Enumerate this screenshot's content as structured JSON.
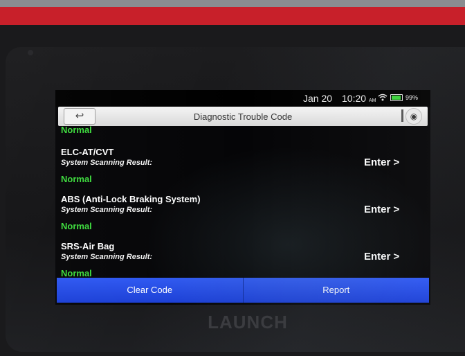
{
  "status_bar": {
    "date": "Jan 20",
    "time": "10:20",
    "ampm": "AM",
    "battery_percent": "99%",
    "wifi_icon": "wifi-icon",
    "battery_icon": "battery-icon"
  },
  "header": {
    "title": "Diagnostic Trouble Code",
    "back_icon": "↩",
    "camera_icon": "◉"
  },
  "list": {
    "partial_status": "Normal",
    "systems": [
      {
        "name": "ELC-AT/CVT",
        "label": "System Scanning Result:",
        "status": "Normal",
        "action": "Enter >"
      },
      {
        "name": "ABS (Anti-Lock Braking System)",
        "label": "System Scanning Result:",
        "status": "Normal",
        "action": "Enter >"
      },
      {
        "name": "SRS-Air Bag",
        "label": "System Scanning Result:",
        "status": "Normal",
        "action": "Enter >"
      }
    ]
  },
  "footer": {
    "clear_code": "Clear Code",
    "report": "Report"
  },
  "device": {
    "brand": "LAUNCH"
  },
  "colors": {
    "normal_status": "#3ddc3d",
    "button_blue": "#1b3fd6",
    "device_red": "#c8202a"
  }
}
